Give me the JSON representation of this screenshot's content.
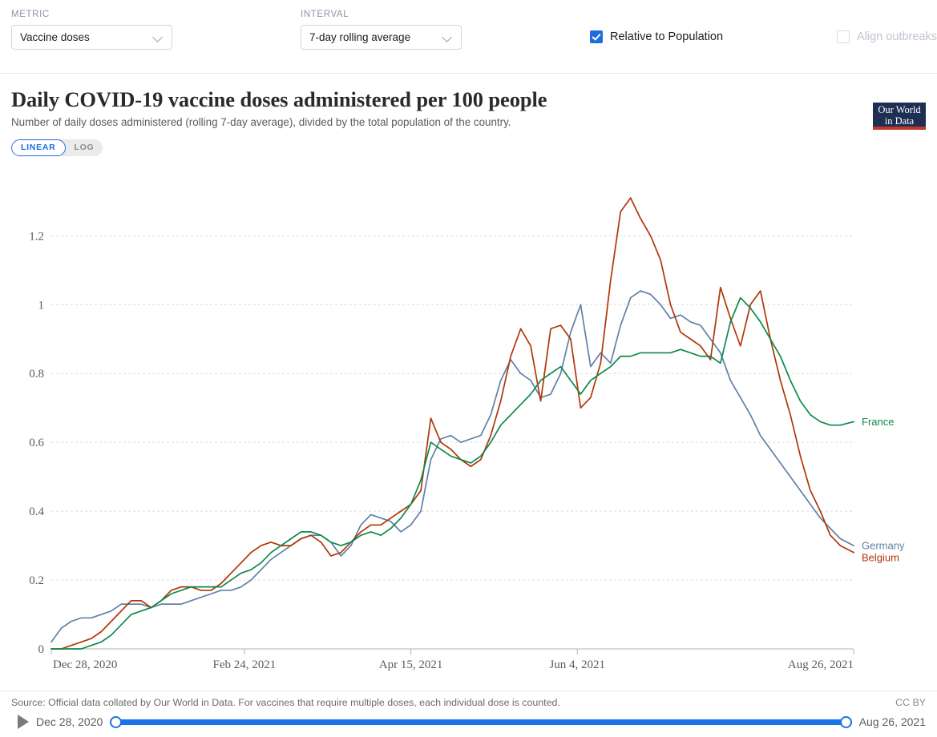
{
  "controls": {
    "metric": {
      "label": "METRIC",
      "value": "Vaccine doses",
      "chevron_icon": "chevron-down-icon"
    },
    "interval": {
      "label": "INTERVAL",
      "value": "7-day rolling average",
      "chevron_icon": "chevron-down-icon"
    },
    "relative_to_population": {
      "label": "Relative to Population",
      "checked": true
    },
    "align_outbreaks": {
      "label": "Align outbreaks",
      "checked": false,
      "disabled": true
    }
  },
  "header": {
    "title": "Daily COVID-19 vaccine doses administered per 100 people",
    "subtitle": "Number of daily doses administered (rolling 7-day average), divided by the total population of the country.",
    "logo_line1": "Our World",
    "logo_line2": "in Data"
  },
  "scale_toggle": {
    "linear": "LINEAR",
    "log": "LOG",
    "active": "LINEAR"
  },
  "footer": {
    "source": "Source: Official data collated by Our World in Data. For vaccines that require multiple doses, each individual dose is counted.",
    "license": "CC BY",
    "play_icon": "play-icon",
    "slider_start": "Dec 28, 2020",
    "slider_end": "Aug 26, 2021"
  },
  "chart_data": {
    "type": "line",
    "title": "Daily COVID-19 vaccine doses administered per 100 people",
    "subtitle": "Number of daily doses administered (rolling 7-day average), divided by the total population of the country.",
    "xlabel": "",
    "ylabel": "",
    "grid": true,
    "legend_position": "right-inline",
    "scale": "linear",
    "ylim": [
      0,
      1.38
    ],
    "yticks": [
      0,
      0.2,
      0.4,
      0.6,
      0.8,
      1,
      1.2
    ],
    "ytick_labels": [
      "0",
      "0.2",
      "0.4",
      "0.6",
      "0.8",
      "1",
      "1.2"
    ],
    "x_range": [
      "Dec 28, 2020",
      "Aug 26, 2021"
    ],
    "xticks": [
      0,
      58,
      108,
      158,
      241
    ],
    "xtick_labels": [
      "Dec 28, 2020",
      "Feb 24, 2021",
      "Apr 15, 2021",
      "Jun 4, 2021",
      "Aug 26, 2021"
    ],
    "x_days_total": 241,
    "series": [
      {
        "name": "Germany",
        "color": "#6080a8",
        "x": [
          0,
          3,
          6,
          9,
          12,
          15,
          18,
          21,
          24,
          27,
          30,
          33,
          36,
          39,
          42,
          45,
          48,
          51,
          54,
          57,
          60,
          63,
          66,
          69,
          72,
          75,
          78,
          81,
          84,
          87,
          90,
          93,
          96,
          99,
          102,
          105,
          108,
          111,
          114,
          117,
          120,
          123,
          126,
          129,
          132,
          135,
          138,
          141,
          144,
          147,
          150,
          153,
          156,
          159,
          162,
          165,
          168,
          171,
          174,
          177,
          180,
          183,
          186,
          189,
          192,
          195,
          198,
          201,
          204,
          207,
          210,
          213,
          216,
          219,
          222,
          225,
          228,
          231,
          234,
          237,
          241
        ],
        "values": [
          0.02,
          0.06,
          0.08,
          0.09,
          0.09,
          0.1,
          0.11,
          0.13,
          0.13,
          0.13,
          0.12,
          0.13,
          0.13,
          0.13,
          0.14,
          0.15,
          0.16,
          0.17,
          0.17,
          0.18,
          0.2,
          0.23,
          0.26,
          0.28,
          0.3,
          0.32,
          0.33,
          0.33,
          0.31,
          0.27,
          0.3,
          0.36,
          0.39,
          0.38,
          0.37,
          0.34,
          0.36,
          0.4,
          0.55,
          0.61,
          0.62,
          0.6,
          0.61,
          0.62,
          0.68,
          0.78,
          0.84,
          0.8,
          0.78,
          0.73,
          0.74,
          0.8,
          0.92,
          1.0,
          0.82,
          0.86,
          0.83,
          0.94,
          1.02,
          1.04,
          1.03,
          1.0,
          0.96,
          0.97,
          0.95,
          0.94,
          0.9,
          0.86,
          0.78,
          0.73,
          0.68,
          0.62,
          0.58,
          0.54,
          0.5,
          0.46,
          0.42,
          0.38,
          0.35,
          0.32,
          0.3
        ]
      },
      {
        "name": "Belgium",
        "color": "#b13507",
        "x": [
          0,
          3,
          6,
          9,
          12,
          15,
          18,
          21,
          24,
          27,
          30,
          33,
          36,
          39,
          42,
          45,
          48,
          51,
          54,
          57,
          60,
          63,
          66,
          69,
          72,
          75,
          78,
          81,
          84,
          87,
          90,
          93,
          96,
          99,
          102,
          105,
          108,
          111,
          114,
          117,
          120,
          123,
          126,
          129,
          132,
          135,
          138,
          141,
          144,
          147,
          150,
          153,
          156,
          159,
          162,
          165,
          168,
          171,
          174,
          177,
          180,
          183,
          186,
          189,
          192,
          195,
          198,
          201,
          204,
          207,
          210,
          213,
          216,
          219,
          222,
          225,
          228,
          231,
          234,
          237,
          241
        ],
        "values": [
          0.0,
          0.0,
          0.01,
          0.02,
          0.03,
          0.05,
          0.08,
          0.11,
          0.14,
          0.14,
          0.12,
          0.14,
          0.17,
          0.18,
          0.18,
          0.17,
          0.17,
          0.19,
          0.22,
          0.25,
          0.28,
          0.3,
          0.31,
          0.3,
          0.3,
          0.32,
          0.33,
          0.31,
          0.27,
          0.28,
          0.31,
          0.34,
          0.36,
          0.36,
          0.38,
          0.4,
          0.42,
          0.46,
          0.67,
          0.6,
          0.58,
          0.55,
          0.53,
          0.55,
          0.62,
          0.72,
          0.85,
          0.93,
          0.88,
          0.72,
          0.93,
          0.94,
          0.9,
          0.7,
          0.73,
          0.83,
          1.07,
          1.27,
          1.31,
          1.25,
          1.2,
          1.13,
          1.0,
          0.92,
          0.9,
          0.88,
          0.84,
          1.05,
          0.96,
          0.88,
          1.0,
          1.04,
          0.9,
          0.78,
          0.68,
          0.56,
          0.46,
          0.4,
          0.33,
          0.3,
          0.28
        ]
      },
      {
        "name": "France",
        "color": "#0b8a4a",
        "x": [
          0,
          3,
          6,
          9,
          12,
          15,
          18,
          21,
          24,
          27,
          30,
          33,
          36,
          39,
          42,
          45,
          48,
          51,
          54,
          57,
          60,
          63,
          66,
          69,
          72,
          75,
          78,
          81,
          84,
          87,
          90,
          93,
          96,
          99,
          102,
          105,
          108,
          111,
          114,
          117,
          120,
          123,
          126,
          129,
          132,
          135,
          138,
          141,
          144,
          147,
          150,
          153,
          156,
          159,
          162,
          165,
          168,
          171,
          174,
          177,
          180,
          183,
          186,
          189,
          192,
          195,
          198,
          201,
          204,
          207,
          210,
          213,
          216,
          219,
          222,
          225,
          228,
          231,
          234,
          237,
          241
        ],
        "values": [
          0.0,
          0.0,
          0.0,
          0.0,
          0.01,
          0.02,
          0.04,
          0.07,
          0.1,
          0.11,
          0.12,
          0.14,
          0.16,
          0.17,
          0.18,
          0.18,
          0.18,
          0.18,
          0.2,
          0.22,
          0.23,
          0.25,
          0.28,
          0.3,
          0.32,
          0.34,
          0.34,
          0.33,
          0.31,
          0.3,
          0.31,
          0.33,
          0.34,
          0.33,
          0.35,
          0.38,
          0.42,
          0.49,
          0.6,
          0.58,
          0.56,
          0.55,
          0.54,
          0.56,
          0.6,
          0.65,
          0.68,
          0.71,
          0.74,
          0.78,
          0.8,
          0.82,
          0.78,
          0.74,
          0.78,
          0.8,
          0.82,
          0.85,
          0.85,
          0.86,
          0.86,
          0.86,
          0.86,
          0.87,
          0.86,
          0.85,
          0.85,
          0.83,
          0.95,
          1.02,
          0.99,
          0.95,
          0.9,
          0.85,
          0.78,
          0.72,
          0.68,
          0.66,
          0.65,
          0.65,
          0.66
        ]
      }
    ]
  }
}
